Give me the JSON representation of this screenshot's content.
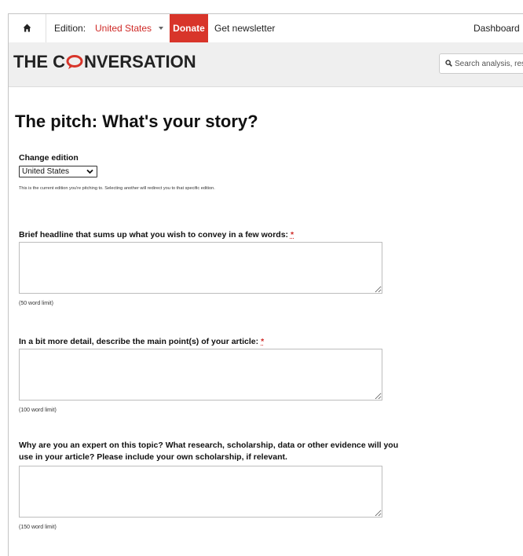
{
  "topbar": {
    "edition_label": "Edition:",
    "edition_value": "United States",
    "donate_label": "Donate",
    "newsletter_label": "Get newsletter",
    "dashboard_label": "Dashboard"
  },
  "header": {
    "logo_text_left": "THE C",
    "logo_text_right": "NVERSATION",
    "search_placeholder": "Search analysis, research, academics…"
  },
  "page": {
    "title": "The pitch: What's your story?"
  },
  "form": {
    "change_edition": {
      "label": "Change edition",
      "selected": "United States",
      "hint": "This is the current edition you're pitching to. Selecting another will redirect you to that specific edition."
    },
    "headline": {
      "label": "Brief headline that sums up what you wish to convey in a few words:",
      "required_mark": "*",
      "limit": "(50 word limit)",
      "value": ""
    },
    "main_points": {
      "label": "In a bit more detail, describe the main point(s) of your article:",
      "required_mark": "*",
      "limit": "(100 word limit)",
      "value": ""
    },
    "expertise": {
      "label_line1": "Why are you an expert on this topic? What research, scholarship, data or other evidence will you",
      "label_line2": "use in your article? Please include your own scholarship, if relevant.",
      "limit": "(150 word limit)",
      "value": ""
    }
  },
  "colors": {
    "brand_red": "#d8352a",
    "edition_red": "#cf2a27",
    "header_bg": "#efefef"
  },
  "icons": [
    "home-icon",
    "caret-down-icon",
    "speech-bubble-logo-icon",
    "search-icon",
    "chevron-down-icon"
  ]
}
